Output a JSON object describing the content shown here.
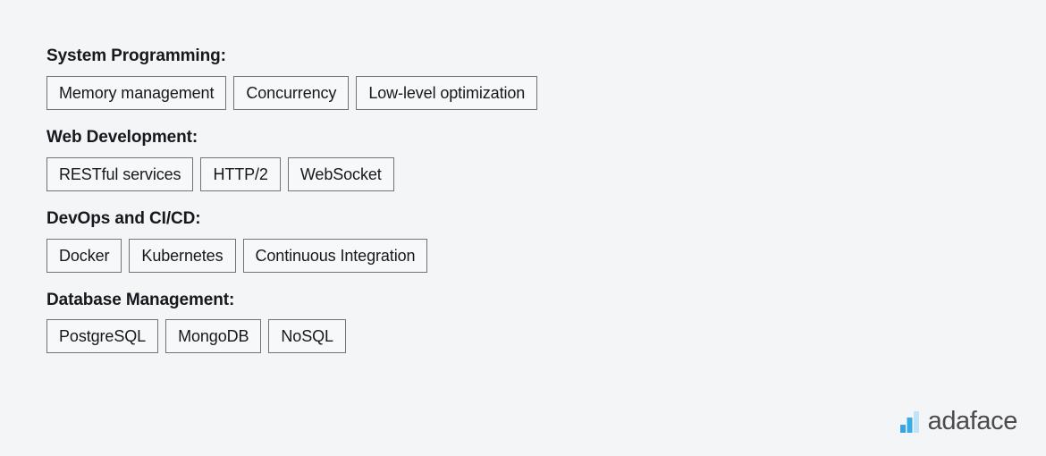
{
  "groups": [
    {
      "heading": "System Programming:",
      "tags": [
        "Memory management",
        "Concurrency",
        "Low-level optimization"
      ]
    },
    {
      "heading": "Web Development:",
      "tags": [
        "RESTful services",
        "HTTP/2",
        "WebSocket"
      ]
    },
    {
      "heading": "DevOps and CI/CD:",
      "tags": [
        "Docker",
        "Kubernetes",
        "Continuous Integration"
      ]
    },
    {
      "heading": "Database Management:",
      "tags": [
        "PostgreSQL",
        "MongoDB",
        "NoSQL"
      ]
    }
  ],
  "brand": {
    "name": "adaface",
    "logo_icon": "bar-chart-logo-icon",
    "bar_colors": [
      "#3aa3e3",
      "#36ace8",
      "#bfe2f7"
    ],
    "name_color": "#4b4b4d"
  },
  "colors": {
    "page_background": "#f4f5f7",
    "tag_border": "#6f7379",
    "tag_background": "#f7f8f9",
    "text": "#16181d"
  }
}
